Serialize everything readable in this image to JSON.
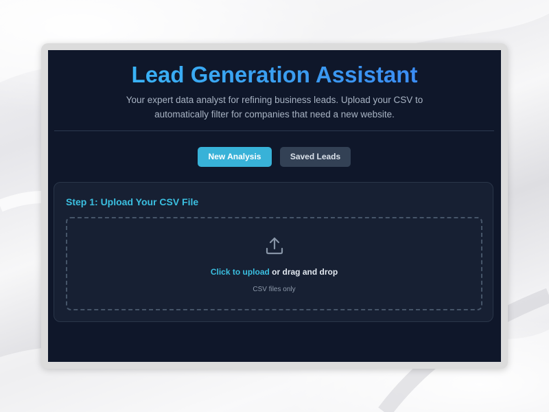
{
  "header": {
    "title": "Lead Generation Assistant",
    "subtitle": "Your expert data analyst for refining business leads. Upload your CSV to automatically filter for companies that need a new website."
  },
  "tabs": [
    {
      "label": "New Analysis",
      "active": true
    },
    {
      "label": "Saved Leads",
      "active": false
    }
  ],
  "upload_card": {
    "title": "Step 1: Upload Your CSV File",
    "icon": "upload-icon",
    "link_text": "Click to upload",
    "rest_text": " or drag and drop",
    "hint": "CSV files only"
  },
  "colors": {
    "app_background": "#0f172a",
    "accent": "#38bdf8",
    "card_background": "#172033",
    "secondary_button": "#334155"
  }
}
